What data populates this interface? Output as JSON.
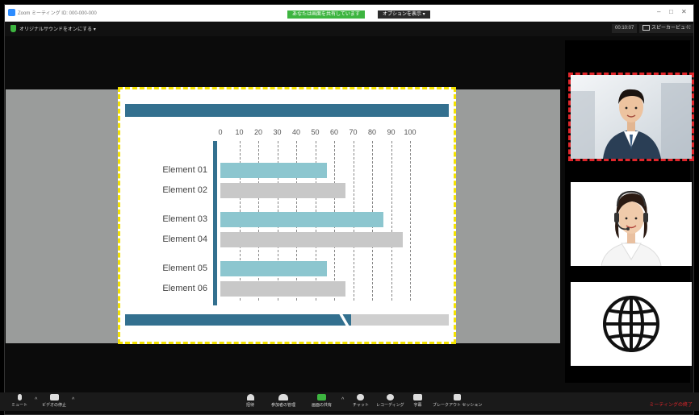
{
  "window": {
    "title": "Zoom ミーティング ID: 000-000-000",
    "share_banner": "あなたは画面を共有しています",
    "options_button": "オプションを表示 ▾"
  },
  "top_bar": {
    "audio_option": "オリジナルサウンドをオンにする",
    "audio_caret": "▾",
    "time": "00:10:07",
    "speaker_view": "スピーカービュー",
    "fullscreen": "⛶"
  },
  "chart_data": {
    "type": "bar",
    "orientation": "horizontal",
    "xlim": [
      0,
      100
    ],
    "ticks": [
      "0",
      "10",
      "20",
      "30",
      "40",
      "50",
      "60",
      "70",
      "80",
      "90",
      "100"
    ],
    "categories": [
      "Element 01",
      "Element 02",
      "Element 03",
      "Element 04",
      "Element 05",
      "Element 06"
    ],
    "values": [
      56,
      66,
      86,
      96,
      56,
      66
    ],
    "colors": [
      "#8cc6cf",
      "#c8c8c8",
      "#8cc6cf",
      "#c8c8c8",
      "#8cc6cf",
      "#c8c8c8"
    ],
    "grid": true
  },
  "colors": {
    "slide_accent": "#33708f",
    "highlight_yellow": "#f4e200",
    "highlight_red": "#e0262b",
    "share_green": "#3db540"
  },
  "participants": [
    {
      "icon": "man-in-suit-photo"
    },
    {
      "icon": "woman-with-headset-photo"
    },
    {
      "icon": "globe-icon"
    }
  ],
  "toolbar": {
    "mute": "ミュート",
    "video_stop": "ビデオの停止",
    "invite": "招待",
    "manage_participants": "参加者の管理",
    "share_screen": "画面の共有",
    "chat": "チャット",
    "record": "レコーディング",
    "captions": "字幕",
    "breakout": "ブレークアウト セッション",
    "end_meeting": "ミーティングの終了"
  }
}
